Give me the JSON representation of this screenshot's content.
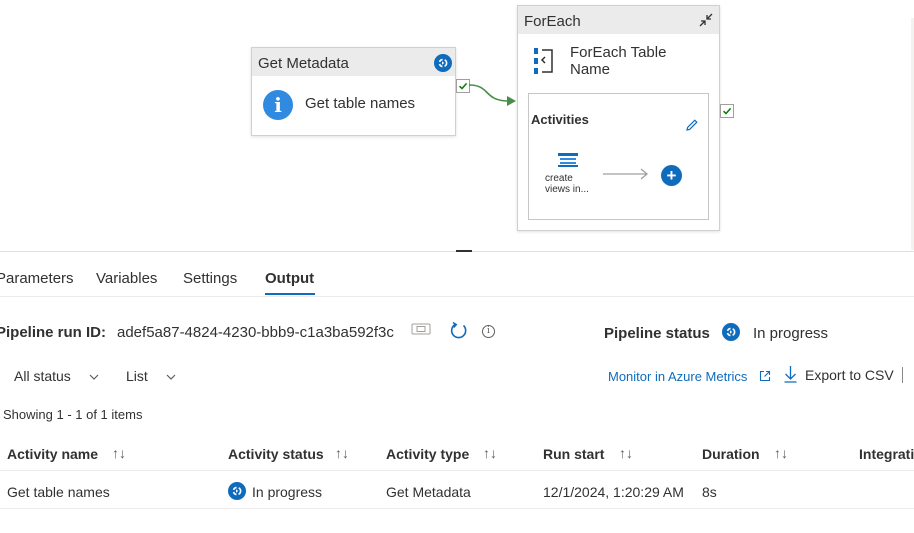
{
  "canvas": {
    "get_metadata": {
      "title": "Get Metadata",
      "activity_label": "Get table names"
    },
    "foreach": {
      "title": "ForEach",
      "subtitle_line1": "ForEach Table",
      "subtitle_line2": "Name",
      "activities_label": "Activities",
      "inner_activity_line1": "create",
      "inner_activity_line2": "views in..."
    }
  },
  "tabs": [
    "Parameters",
    "Variables",
    "Settings",
    "Output"
  ],
  "active_tab": "Output",
  "output": {
    "run_id_label": "Pipeline run ID:",
    "run_id": "adef5a87-4824-4230-bbb9-c1a3ba592f3c",
    "status_label": "Pipeline status",
    "status_value": "In progress",
    "filter_status": "All status",
    "filter_view": "List",
    "monitor_link": "Monitor in Azure Metrics",
    "export": "Export to CSV",
    "showing": "Showing 1 - 1 of 1 items"
  },
  "table": {
    "columns": [
      "Activity name",
      "Activity status",
      "Activity type",
      "Run start",
      "Duration",
      "Integrati"
    ],
    "rows": [
      {
        "name": "Get table names",
        "status": "In progress",
        "type": "Get Metadata",
        "run_start": "12/1/2024, 1:20:29 AM",
        "duration": "8s"
      }
    ]
  },
  "colors": {
    "accent": "#0f6cbd",
    "success": "#107c10",
    "connector": "#4a8c4a"
  },
  "icons": [
    "info-icon",
    "in-progress-icon",
    "checkmark-icon",
    "collapse-icon",
    "foreach-icon",
    "edit-icon",
    "dataflow-icon",
    "add-icon",
    "copy-icon",
    "refresh-icon",
    "info-outline-icon",
    "chevron-down-icon",
    "external-link-icon",
    "download-icon",
    "sort-icon"
  ]
}
